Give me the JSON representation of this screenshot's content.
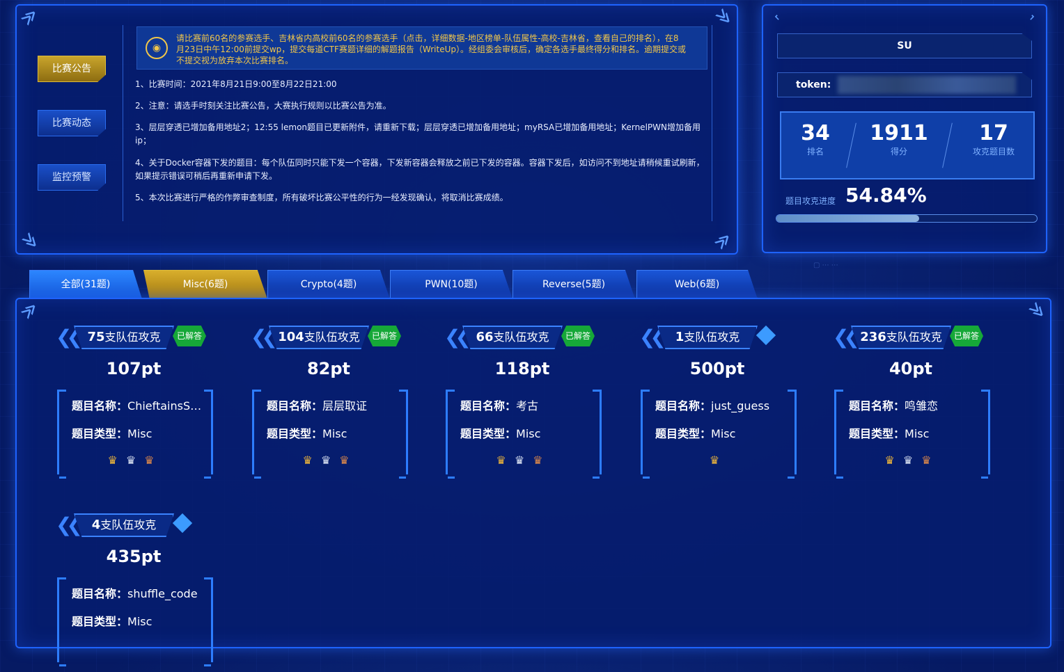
{
  "nav": {
    "items": [
      "比赛公告",
      "比赛动态",
      "监控预警"
    ],
    "active": 0
  },
  "notice": {
    "text": "请比赛前60名的参赛选手、吉林省内高校前60名的参赛选手（点击，详细数据-地区榜单-队伍属性-高校-吉林省，查看自己的排名），在8月23日中午12:00前提交wp，提交每道CTF赛题详细的解题报告（WriteUp）。经组委会审核后，确定各选手最终得分和排名。逾期提交或不提交视为放弃本次比赛排名。"
  },
  "rules": [
    "1、比赛时间：2021年8月21日9:00至8月22日21:00",
    "2、注意：请选手时刻关注比赛公告，大赛执行规则以比赛公告为准。",
    "3、层层穿透已增加备用地址2；12:55 lemon题目已更新附件，请重新下载；层层穿透已增加备用地址；myRSA已增加备用地址；KernelPWN增加备用ip；",
    "4、关于Docker容器下发的题目：每个队伍同时只能下发一个容器，下发新容器会释放之前已下发的容器。容器下发后，如访问不到地址请稍候重试刷新，如果提示错误可稍后再重新申请下发。",
    "5、本次比赛进行严格的作弊审查制度，所有破坏比赛公平性的行为一经发现确认，将取消比赛成绩。"
  ],
  "user": {
    "name": "SU",
    "token_label": "token:",
    "rank": "34",
    "rank_label": "排名",
    "score": "1911",
    "score_label": "得分",
    "solved": "17",
    "solved_label": "攻克题目数",
    "progress_label": "题目攻克进度",
    "progress_text": "54.84%",
    "progress": 0.5484
  },
  "tabs": [
    {
      "label": "全部(31题)"
    },
    {
      "label": "Misc(6题)"
    },
    {
      "label": "Crypto(4题)"
    },
    {
      "label": "PWN(10题)"
    },
    {
      "label": "Reverse(5题)"
    },
    {
      "label": "Web(6题)"
    }
  ],
  "active_tab": 1,
  "labels": {
    "name": "题目名称：",
    "type": "题目类型：",
    "solved_badge": "已解答",
    "team_suffix": "支队伍攻克"
  },
  "challenges": [
    {
      "teams": "75",
      "points": "107pt",
      "name": "ChieftainsSe...",
      "type": "Misc",
      "solved": true,
      "crowns": 3
    },
    {
      "teams": "104",
      "points": "82pt",
      "name": "层层取证",
      "type": "Misc",
      "solved": true,
      "crowns": 3
    },
    {
      "teams": "66",
      "points": "118pt",
      "name": "考古",
      "type": "Misc",
      "solved": true,
      "crowns": 3
    },
    {
      "teams": "1",
      "points": "500pt",
      "name": "just_guess",
      "type": "Misc",
      "solved": false,
      "crowns": 1
    },
    {
      "teams": "236",
      "points": "40pt",
      "name": "鸣雏恋",
      "type": "Misc",
      "solved": true,
      "crowns": 3
    },
    {
      "teams": "4",
      "points": "435pt",
      "name": "shuffle_code",
      "type": "Misc",
      "solved": false,
      "crowns": 0
    }
  ]
}
